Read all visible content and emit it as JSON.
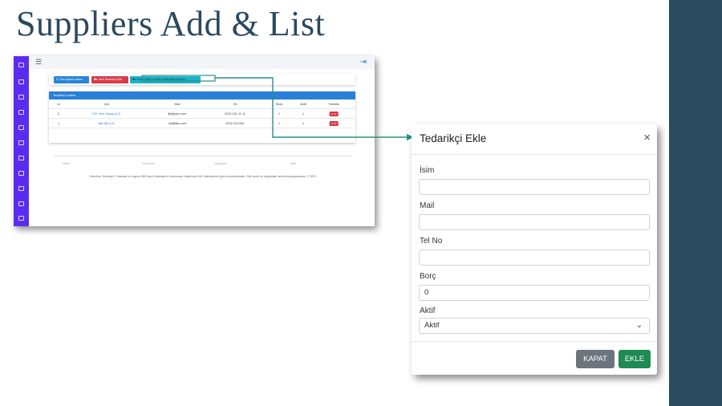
{
  "slide": {
    "title": "Suppliers Add & List"
  },
  "app": {
    "toolbar": {
      "btn_list": "☷ Tüm Aşılar Listesi",
      "btn_new": "⛟ Yeni Tedarikçi Ekle",
      "btn_third": "⛟ Eksik Stok ve Stok Hareketleri Raporu"
    },
    "card": {
      "title": "Tedarikçi Listesi",
      "columns": [
        "Id",
        "Adı",
        "Mail",
        "Tel",
        "Borç",
        "Aktif",
        "Yönetim"
      ],
      "rows": [
        {
          "id": "2",
          "name": "FJK Yem Sanayi A.Ş.",
          "mail": "fjk@yem.com",
          "tel": "0212 221 11 11",
          "debt": "0",
          "active": "1",
          "action": "⊘ Sil"
        },
        {
          "id": "1",
          "name": "Nat İlaç A.Ş.",
          "mail": "nat@ilac.com",
          "tel": "0232 1112311",
          "debt": "0",
          "active": "1",
          "action": "⊘ Sil"
        }
      ]
    },
    "footer": {
      "social": [
        "Twitter",
        "Facebook",
        "Instagram",
        "Mail"
      ],
      "copyright": "Veteriner Teknoloji © markası ve logosu 556 Sayılı Markaların Korunması Hakkında KHK hükümlerine göre korunmaktadır. Site içerik ve fotoğrafları izinsiz kopyalanamaz. © 2021"
    }
  },
  "modal": {
    "title": "Tedarikçi Ekle",
    "close_symbol": "×",
    "fields": {
      "name": {
        "label": "İsim",
        "value": ""
      },
      "mail": {
        "label": "Mail",
        "value": ""
      },
      "tel": {
        "label": "Tel No",
        "value": ""
      },
      "debt": {
        "label": "Borç",
        "value": "0"
      },
      "active": {
        "label": "Aktif",
        "value": "Aktif"
      }
    },
    "buttons": {
      "close": "KAPAT",
      "add": "EKLE"
    }
  },
  "colors": {
    "sidebar": "#5b2cf0",
    "card_header": "#2a7fd8",
    "delete": "#dc3545",
    "close_button": "#6c757d",
    "add_button": "#1e8a54",
    "connector": "#2a8f8a",
    "right_band": "#2b4b60"
  },
  "icons": {
    "menu": "hamburger-icon",
    "logout": "logout-icon",
    "modal_close": "close-icon",
    "select": "chevron-down-icon"
  }
}
